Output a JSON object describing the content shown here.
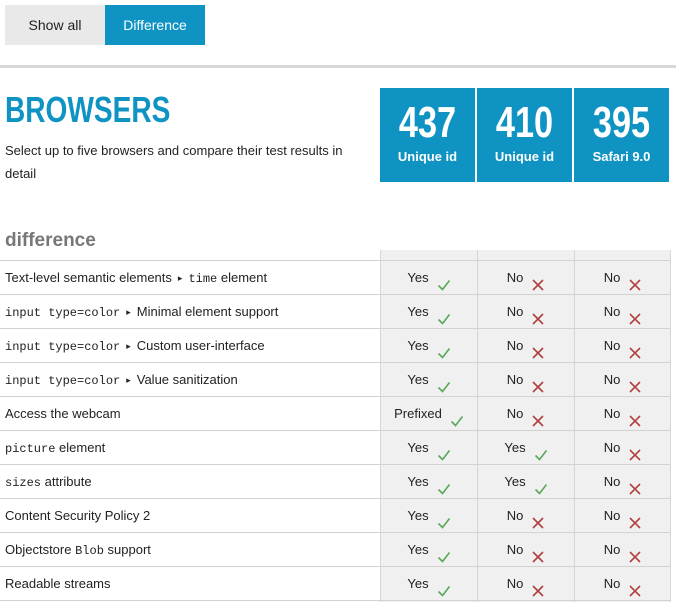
{
  "tabs": {
    "show_all": "Show all",
    "difference": "Difference"
  },
  "header": {
    "title": "BROWSERS",
    "subtitle": "Select up to five browsers and compare their test results in detail"
  },
  "scores": [
    {
      "score": "437",
      "label": "Unique id"
    },
    {
      "score": "410",
      "label": "Unique id"
    },
    {
      "score": "395",
      "label": "Safari 9.0"
    }
  ],
  "section_title": "difference",
  "colors": {
    "accent": "#0e93c3",
    "yes": "#5aa85a",
    "no": "#b04040"
  },
  "rows": [
    {
      "parts": [
        {
          "t": "Text-level semantic elements"
        },
        {
          "t": "▸",
          "arrow": true
        },
        {
          "t": "time",
          "mono": true
        },
        {
          "t": " element"
        }
      ],
      "results": [
        {
          "text": "Yes",
          "ok": true
        },
        {
          "text": "No",
          "ok": false
        },
        {
          "text": "No",
          "ok": false
        }
      ]
    },
    {
      "parts": [
        {
          "t": "input type=color",
          "mono": true
        },
        {
          "t": "▸",
          "arrow": true
        },
        {
          "t": "Minimal element support"
        }
      ],
      "results": [
        {
          "text": "Yes",
          "ok": true
        },
        {
          "text": "No",
          "ok": false
        },
        {
          "text": "No",
          "ok": false
        }
      ]
    },
    {
      "parts": [
        {
          "t": "input type=color",
          "mono": true
        },
        {
          "t": "▸",
          "arrow": true
        },
        {
          "t": "Custom user-interface"
        }
      ],
      "results": [
        {
          "text": "Yes",
          "ok": true
        },
        {
          "text": "No",
          "ok": false
        },
        {
          "text": "No",
          "ok": false
        }
      ]
    },
    {
      "parts": [
        {
          "t": "input type=color",
          "mono": true
        },
        {
          "t": "▸",
          "arrow": true
        },
        {
          "t": "Value sanitization"
        }
      ],
      "results": [
        {
          "text": "Yes",
          "ok": true
        },
        {
          "text": "No",
          "ok": false
        },
        {
          "text": "No",
          "ok": false
        }
      ]
    },
    {
      "parts": [
        {
          "t": "Access the webcam"
        }
      ],
      "results": [
        {
          "text": "Prefixed",
          "ok": true
        },
        {
          "text": "No",
          "ok": false
        },
        {
          "text": "No",
          "ok": false
        }
      ]
    },
    {
      "parts": [
        {
          "t": "picture",
          "mono": true
        },
        {
          "t": " element"
        }
      ],
      "results": [
        {
          "text": "Yes",
          "ok": true
        },
        {
          "text": "Yes",
          "ok": true
        },
        {
          "text": "No",
          "ok": false
        }
      ]
    },
    {
      "parts": [
        {
          "t": "sizes",
          "mono": true
        },
        {
          "t": " attribute"
        }
      ],
      "results": [
        {
          "text": "Yes",
          "ok": true
        },
        {
          "text": "Yes",
          "ok": true
        },
        {
          "text": "No",
          "ok": false
        }
      ]
    },
    {
      "parts": [
        {
          "t": "Content Security Policy 2"
        }
      ],
      "results": [
        {
          "text": "Yes",
          "ok": true
        },
        {
          "text": "No",
          "ok": false
        },
        {
          "text": "No",
          "ok": false
        }
      ]
    },
    {
      "parts": [
        {
          "t": "Objectstore "
        },
        {
          "t": "Blob",
          "mono": true
        },
        {
          "t": " support"
        }
      ],
      "results": [
        {
          "text": "Yes",
          "ok": true
        },
        {
          "text": "No",
          "ok": false
        },
        {
          "text": "No",
          "ok": false
        }
      ]
    },
    {
      "parts": [
        {
          "t": "Readable streams"
        }
      ],
      "results": [
        {
          "text": "Yes",
          "ok": true
        },
        {
          "text": "No",
          "ok": false
        },
        {
          "text": "No",
          "ok": false
        }
      ]
    }
  ]
}
